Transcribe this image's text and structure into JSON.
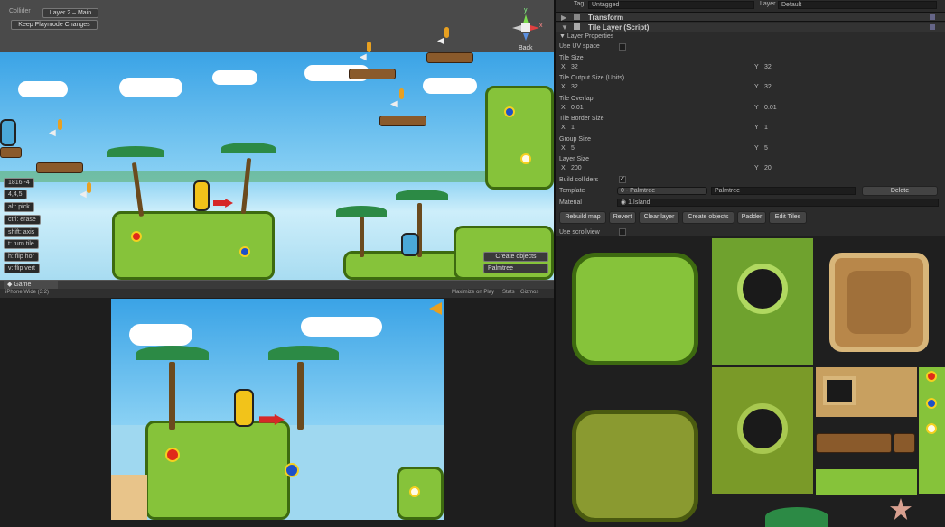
{
  "scene": {
    "layer_dropdown": "Layer 2 – Main",
    "keep_playmode": "Keep Playmode Changes",
    "back_label": "Back",
    "gizmo_y": "y",
    "gizmo_x": "x",
    "coords": "1816,-4",
    "tile_index": "4,4,5",
    "tools": [
      "alt: pick",
      "ctrl: erase",
      "shift: axis",
      "t: turn tile",
      "h: flip hor",
      "v: flip vert"
    ],
    "create_objects": "Create objects",
    "palm_select": "Palmtree"
  },
  "game": {
    "tab": "Game",
    "resolution": "iPhone Wide (3:2)",
    "maximize": "Maximize on Play",
    "stats": "Stats",
    "gizmos": "Gizmos"
  },
  "inspector": {
    "tag_label": "Tag",
    "tag_value": "Untagged",
    "layer_label": "Layer",
    "layer_value": "Default",
    "transform": "Transform",
    "tile_layer": "Tile Layer (Script)",
    "layer_properties": "Layer Properties",
    "use_uv_space": "Use UV space",
    "tile_size": {
      "label": "Tile Size",
      "x": "32",
      "y": "32"
    },
    "tile_output": {
      "label": "Tile Output Size (Units)",
      "x": "32",
      "y": "32"
    },
    "tile_overlap": {
      "label": "Tile Overlap",
      "x": "0.01",
      "y": "0.01"
    },
    "tile_border": {
      "label": "Tile Border Size",
      "x": "1",
      "y": "1"
    },
    "group_size": {
      "label": "Group Size",
      "x": "5",
      "y": "5"
    },
    "layer_size": {
      "label": "Layer Size",
      "x": "200",
      "y": "20"
    },
    "x_label": "X",
    "y_label": "Y",
    "build_colliders": "Build colliders",
    "template_label": "Template",
    "template_value": "0 - Palmtree",
    "template_name": "Palmtree",
    "delete_label": "Delete",
    "material_label": "Material",
    "material_value": "1.Island",
    "buttons": [
      "Rebuild map",
      "Revert",
      "Clear layer",
      "Create objects",
      "Padder",
      "Edit Tiles"
    ],
    "use_scrollview": "Use scrollview"
  },
  "colors": {
    "editor_bg": "#1e1e1e",
    "panel_bg": "#2b2b2b",
    "sky": "#58b4ea",
    "grass": "#86c33a",
    "grass_dark": "#3d6a10",
    "wood": "#8a5a2b"
  }
}
